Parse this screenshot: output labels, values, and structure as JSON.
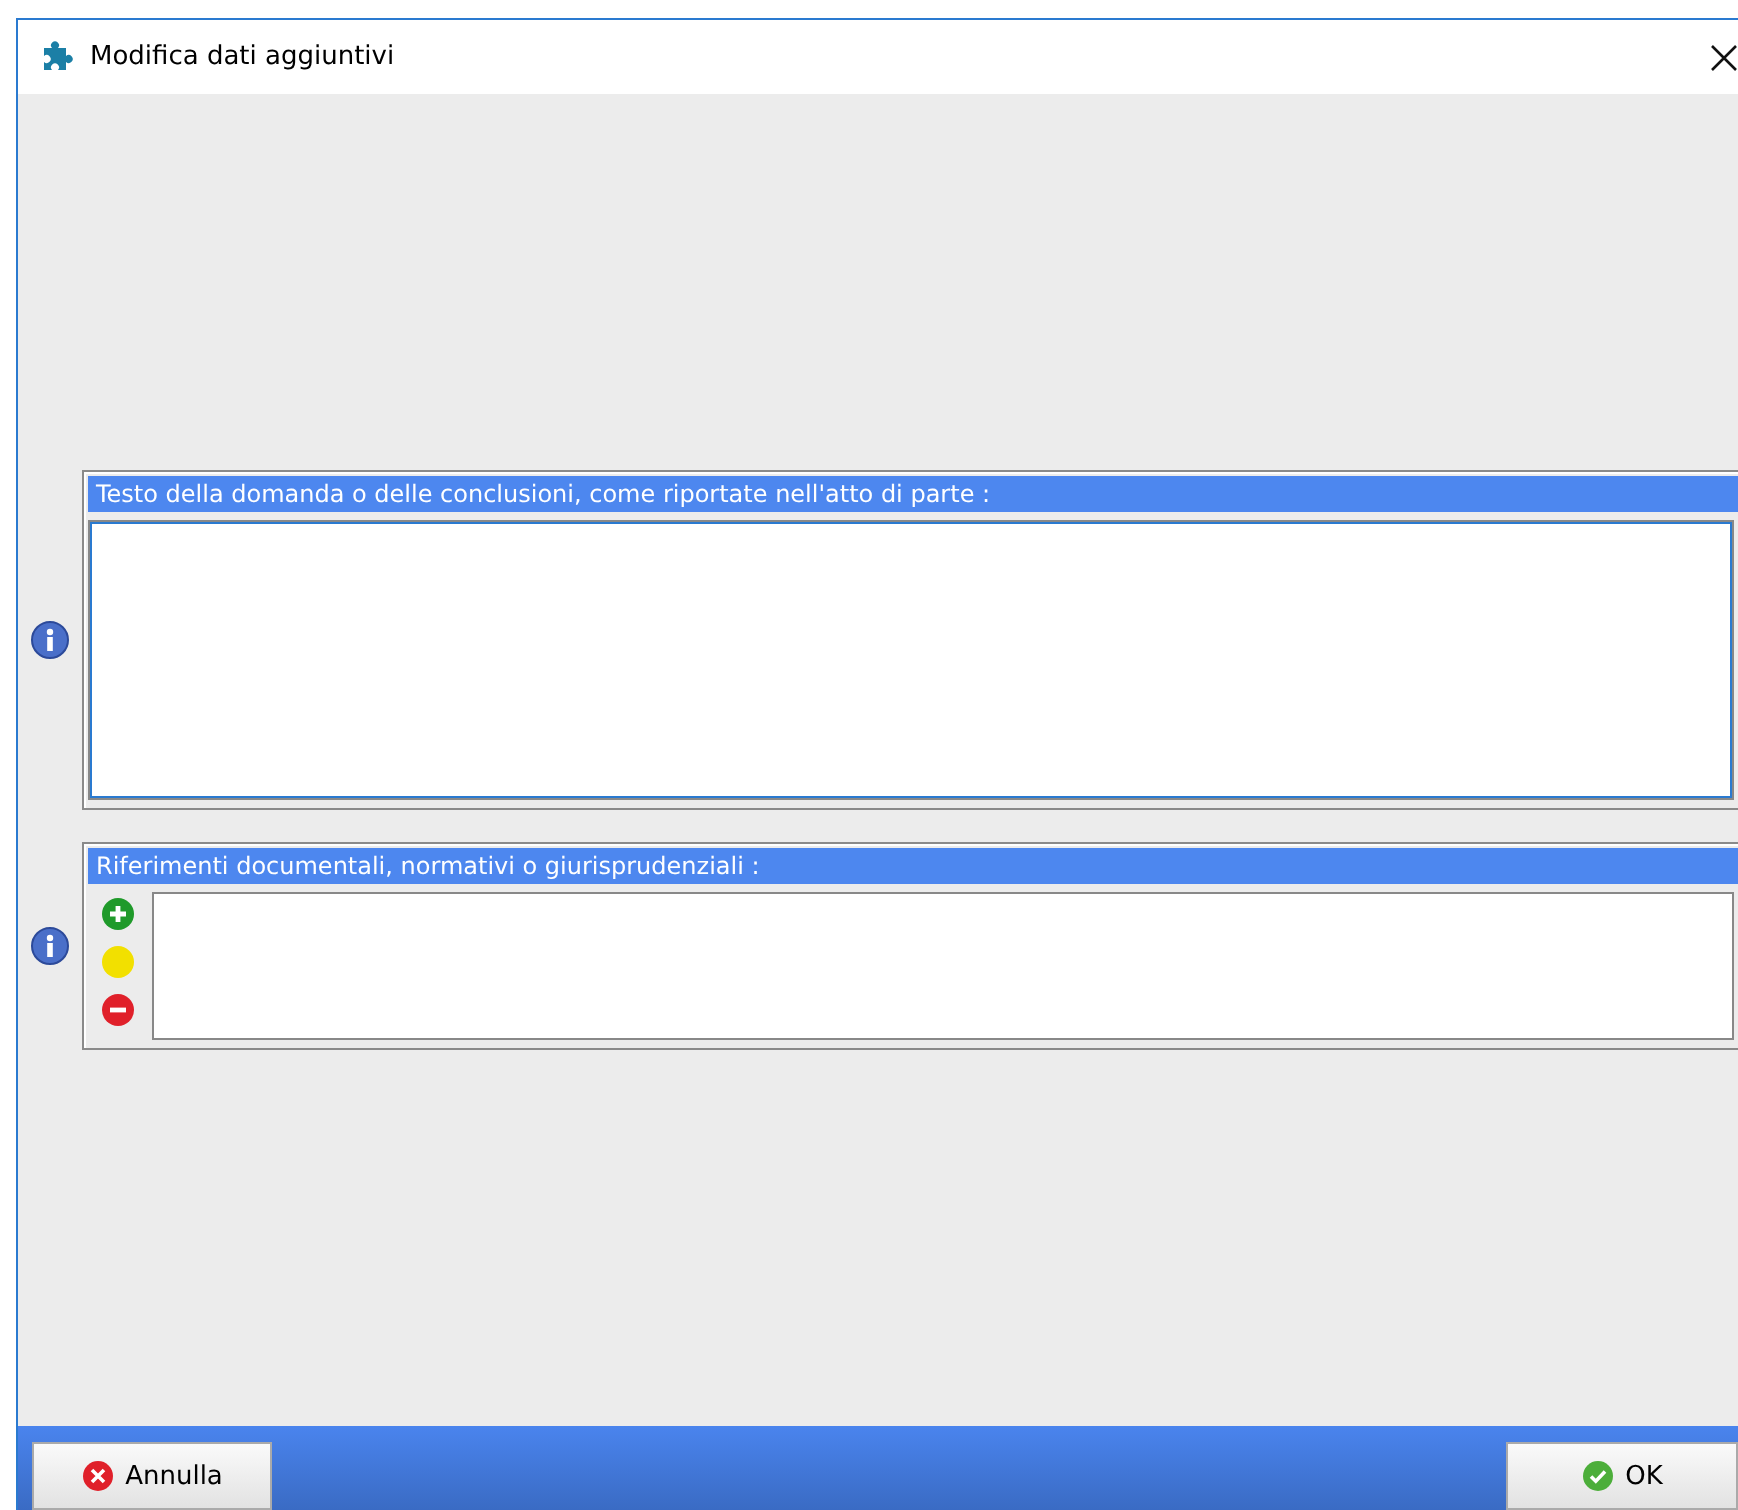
{
  "window": {
    "title": "Modifica dati aggiuntivi"
  },
  "sections": [
    {
      "kind": "text",
      "label": "Testo della domanda o delle conclusioni, come riportate nell'atto di parte :",
      "focused": true
    },
    {
      "kind": "list",
      "label": "Riferimenti documentali, normativi o giurisprudenziali :"
    }
  ],
  "buttons": [
    {
      "kind": "cancel",
      "label": "Annulla"
    },
    {
      "kind": "ok",
      "label": "OK"
    }
  ]
}
